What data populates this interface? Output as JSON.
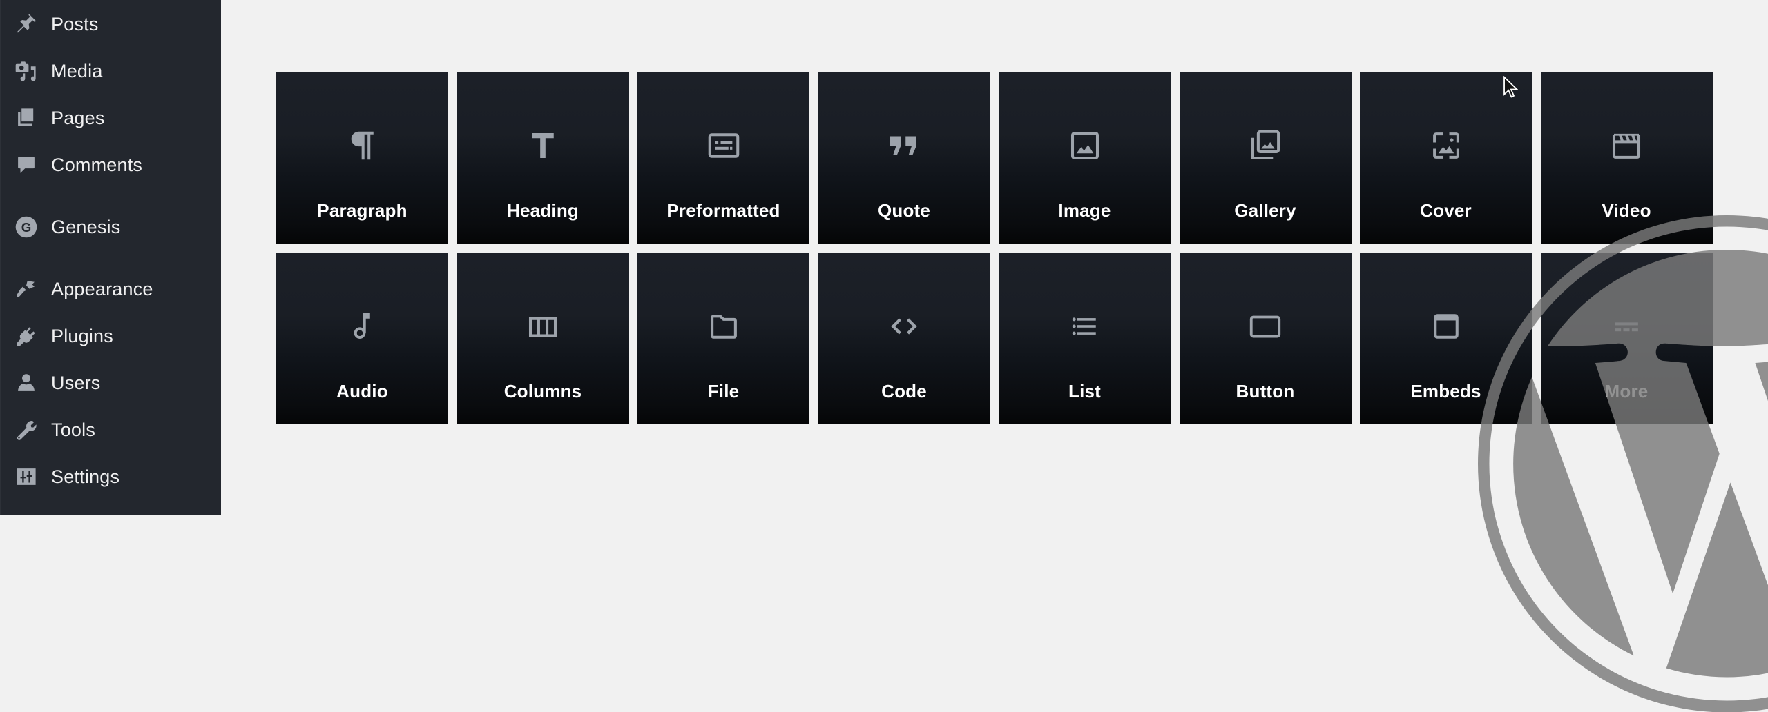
{
  "sidebar": {
    "items": [
      {
        "label": "Posts",
        "icon": "pushpin-icon"
      },
      {
        "label": "Media",
        "icon": "media-icon"
      },
      {
        "label": "Pages",
        "icon": "pages-icon"
      },
      {
        "label": "Comments",
        "icon": "comment-icon"
      },
      {
        "label": "Genesis",
        "icon": "genesis-g-icon",
        "badge_letter": "G"
      },
      {
        "label": "Appearance",
        "icon": "paintbrush-icon"
      },
      {
        "label": "Plugins",
        "icon": "plug-icon"
      },
      {
        "label": "Users",
        "icon": "user-icon"
      },
      {
        "label": "Tools",
        "icon": "wrench-icon"
      },
      {
        "label": "Settings",
        "icon": "sliders-icon"
      }
    ]
  },
  "blocks": {
    "rows": [
      [
        {
          "label": "Paragraph",
          "icon": "paragraph-icon"
        },
        {
          "label": "Heading",
          "icon": "heading-icon"
        },
        {
          "label": "Preformatted",
          "icon": "preformatted-icon"
        },
        {
          "label": "Quote",
          "icon": "quote-icon"
        },
        {
          "label": "Image",
          "icon": "image-icon"
        },
        {
          "label": "Gallery",
          "icon": "gallery-icon"
        },
        {
          "label": "Cover",
          "icon": "cover-icon"
        },
        {
          "label": "Video",
          "icon": "video-icon"
        }
      ],
      [
        {
          "label": "Audio",
          "icon": "audio-icon"
        },
        {
          "label": "Columns",
          "icon": "columns-icon"
        },
        {
          "label": "File",
          "icon": "file-icon"
        },
        {
          "label": "Code",
          "icon": "code-icon"
        },
        {
          "label": "List",
          "icon": "list-icon"
        },
        {
          "label": "Button",
          "icon": "button-icon"
        },
        {
          "label": "Embeds",
          "icon": "embeds-icon"
        },
        {
          "label": "More",
          "icon": "more-icon"
        }
      ]
    ]
  },
  "colors": {
    "sidebar_bg": "#23272e",
    "sidebar_icon": "#a3a8b0",
    "tile_icon": "#9da3ab",
    "page_bg": "#f1f1f1",
    "watermark": "#808080"
  }
}
